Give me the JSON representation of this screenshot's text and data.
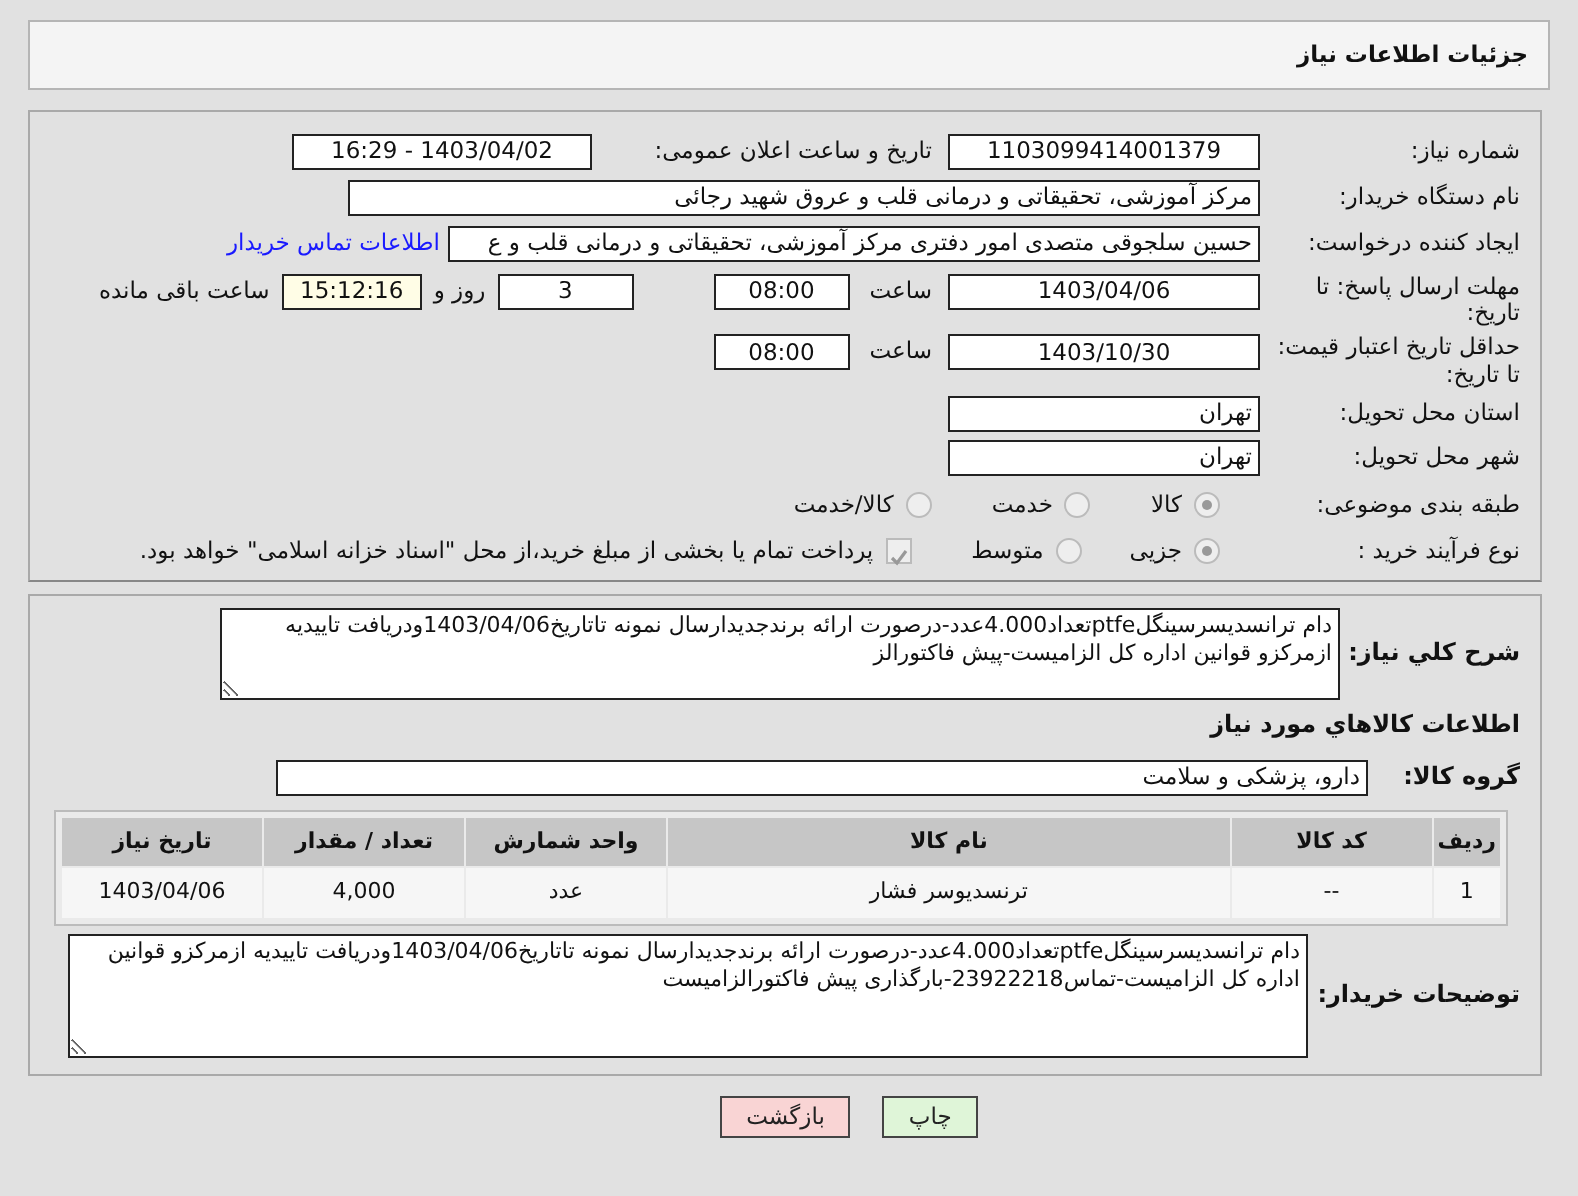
{
  "header": {
    "title": "جزئیات اطلاعات نیاز"
  },
  "need_number": {
    "label": "شماره نیاز:",
    "value": "1103099414001379"
  },
  "announce": {
    "label": "تاریخ و ساعت اعلان عمومی:",
    "value": "1403/04/02 - 16:29"
  },
  "buyer_org": {
    "label": "نام دستگاه خریدار:",
    "value": "مرکز آموزشی، تحقیقاتی و درمانی قلب و عروق شهید رجائی"
  },
  "requester": {
    "label": "ایجاد کننده درخواست:",
    "value": "حسین سلجوقی متصدی امور دفتری مرکز آموزشی، تحقیقاتی و درمانی قلب و ع",
    "link": "اطلاعات تماس خریدار"
  },
  "reply_deadline": {
    "label": "مهلت ارسال پاسخ: تا تاریخ:",
    "date": "1403/04/06",
    "time_label": "ساعت",
    "time": "08:00",
    "days": "3",
    "days_label": "روز و",
    "remaining": "15:12:16",
    "remaining_label": "ساعت باقی مانده"
  },
  "price_validity": {
    "label": "حداقل تاریخ اعتبار قیمت: تا تاریخ:",
    "date": "1403/10/30",
    "time_label": "ساعت",
    "time": "08:00"
  },
  "province": {
    "label": "استان محل تحویل:",
    "value": "تهران"
  },
  "city": {
    "label": "شهر محل تحویل:",
    "value": "تهران"
  },
  "category": {
    "label": "طبقه بندی موضوعی:",
    "options": [
      {
        "label": "کالا",
        "selected": true
      },
      {
        "label": "خدمت",
        "selected": false
      },
      {
        "label": "کالا/خدمت",
        "selected": false
      }
    ]
  },
  "process": {
    "label": "نوع فرآیند خرید :",
    "options": [
      {
        "label": "جزیی",
        "selected": true
      },
      {
        "label": "متوسط",
        "selected": false
      }
    ],
    "treasury": {
      "checked": true,
      "text": "پرداخت تمام یا بخشی از مبلغ خرید،از محل \"اسناد خزانه اسلامی\" خواهد بود."
    }
  },
  "summary": {
    "label": "شرح کلي نياز:",
    "value": "دام ترانسدیسرسینگلptfeتعداد4.000عدد-درصورت ارائه برندجدیدارسال نمونه تاتاریخ1403/04/06ودریافت تاییدیه ازمرکزو قوانین اداره کل الزامیست-پیش فاکتورالز"
  },
  "goods_heading": "اطلاعات کالاهاي مورد نياز",
  "goods_group": {
    "label": "گروه کالا:",
    "value": "دارو، پزشکی و سلامت"
  },
  "table": {
    "columns": [
      "ردیف",
      "کد کالا",
      "نام کالا",
      "واحد شمارش",
      "تعداد / مقدار",
      "تاریخ نیاز"
    ],
    "rows": [
      [
        "1",
        "--",
        "ترنسدیوسر فشار",
        "عدد",
        "4,000",
        "1403/04/06"
      ]
    ]
  },
  "buyer_notes": {
    "label": "توضیحات خریدار:",
    "value": "دام ترانسدیسرسینگلptfeتعداد4.000عدد-درصورت ارائه برندجدیدارسال نمونه تاتاریخ1403/04/06ودریافت تاییدیه ازمرکزو قوانین اداره کل الزامیست-تماس23922218-بارگذاری پیش فاکتورالزامیست"
  },
  "buttons": [
    {
      "label": "چاپ",
      "kind": "print"
    },
    {
      "label": "بازگشت",
      "kind": "back"
    }
  ]
}
